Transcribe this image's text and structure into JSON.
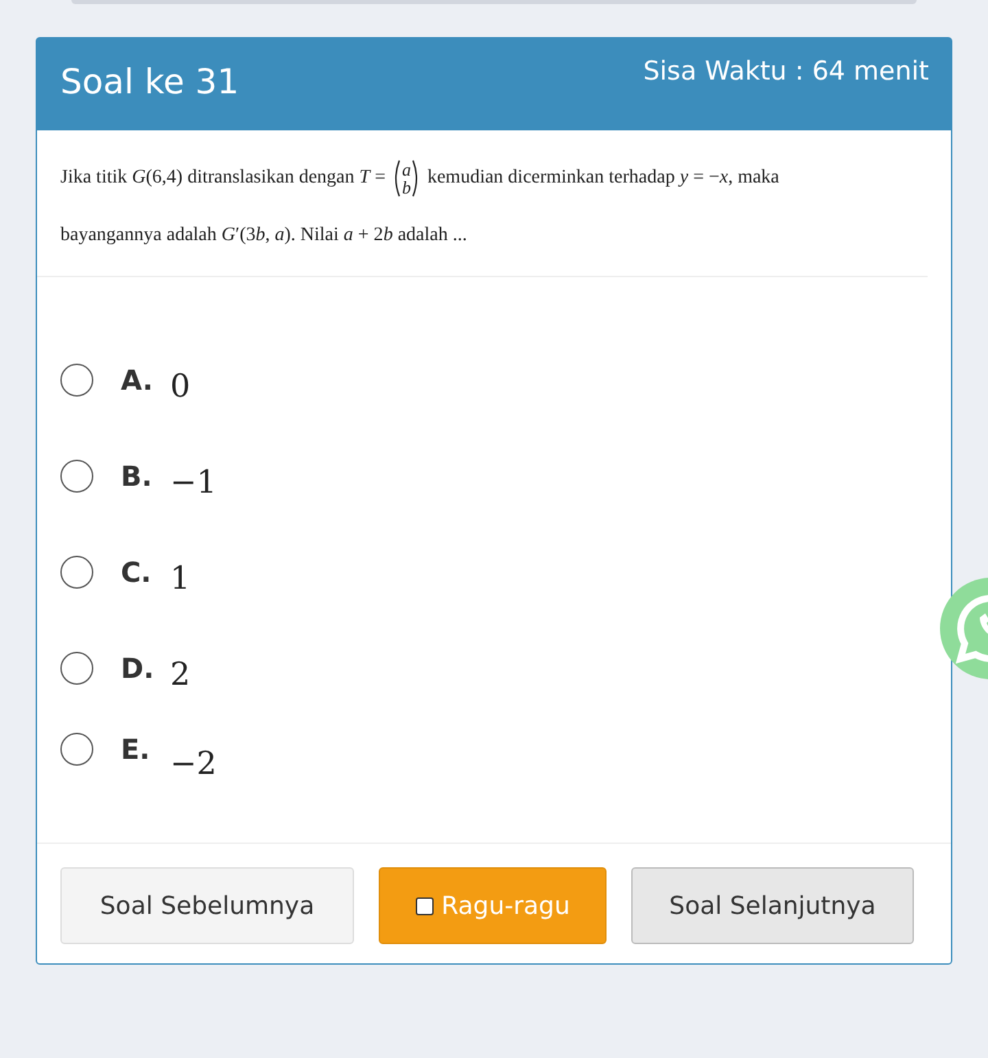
{
  "header": {
    "title": "Soal ke 31",
    "timer": "Sisa Waktu : 64 menit"
  },
  "question": {
    "line_1": [
      {
        "kind": "text",
        "parts": [
          {
            "text": "Jika titik ",
            "italic": false
          },
          {
            "text": "G",
            "italic": true
          },
          {
            "text": "(6,4) ditranslasikan dengan ",
            "italic": false
          },
          {
            "text": "T",
            "italic": true
          },
          {
            "text": " =",
            "italic": false
          }
        ]
      },
      {
        "kind": "matrix",
        "top": "a",
        "bottom": "b"
      },
      {
        "kind": "text",
        "parts": [
          {
            "text": "kemudian dicerminkan terhadap ",
            "italic": false
          },
          {
            "text": "y",
            "italic": true
          },
          {
            "text": " = −",
            "italic": false
          },
          {
            "text": "x",
            "italic": true
          },
          {
            "text": ", maka",
            "italic": false
          }
        ]
      }
    ],
    "line_2": [
      {
        "text": "bayangannya adalah ",
        "italic": false
      },
      {
        "text": "G",
        "italic": true
      },
      {
        "text": "′(3",
        "italic": false
      },
      {
        "text": "b",
        "italic": true
      },
      {
        "text": ", ",
        "italic": false
      },
      {
        "text": "a",
        "italic": true
      },
      {
        "text": "). Nilai ",
        "italic": false
      },
      {
        "text": "a",
        "italic": true
      },
      {
        "text": " + 2",
        "italic": false
      },
      {
        "text": "b",
        "italic": true
      },
      {
        "text": " adalah ...",
        "italic": false
      }
    ]
  },
  "options": [
    {
      "letter": "A.",
      "value": "0",
      "selected": false
    },
    {
      "letter": "B.",
      "value": "−1",
      "selected": false
    },
    {
      "letter": "C.",
      "value": "1",
      "selected": false
    },
    {
      "letter": "D.",
      "value": "2",
      "selected": false
    },
    {
      "letter": "E.",
      "value": "−2",
      "selected": false
    }
  ],
  "buttons": {
    "previous": "Soal Sebelumnya",
    "doubt": {
      "label": "Ragu-ragu",
      "checked": false
    },
    "next": "Soal Selanjutnya"
  }
}
